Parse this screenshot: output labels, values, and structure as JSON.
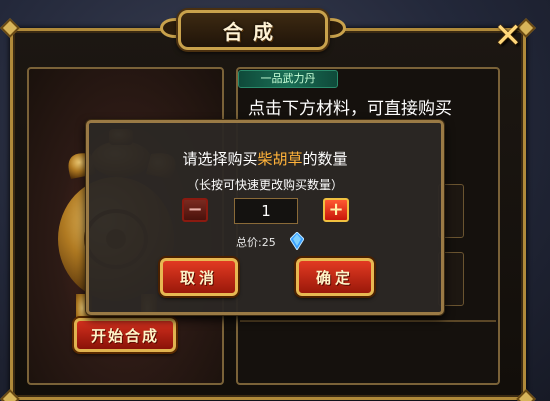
{
  "window": {
    "title": "合成",
    "close_icon": "close-x-icon"
  },
  "right_panel": {
    "item_name": "一品武力丹",
    "hint": "点击下方材料，可直接购买"
  },
  "left_panel": {
    "start_button": "开始合成"
  },
  "dialog": {
    "prompt_prefix": "请选择购买",
    "material": "柴胡草",
    "prompt_suffix": "的数量",
    "subtitle": "（长按可快速更改购买数量）",
    "quantity": "1",
    "price_label": "总价:25",
    "cancel_label": "取消",
    "confirm_label": "确定",
    "minus_icon": "minus-icon",
    "plus_icon": "plus-icon",
    "currency_icon": "blue-gem-icon"
  },
  "colors": {
    "frame_gold": "#b08a3a",
    "highlight_orange": "#ffb23a",
    "button_red": "#c8160a",
    "tag_green": "#1a6e55"
  }
}
